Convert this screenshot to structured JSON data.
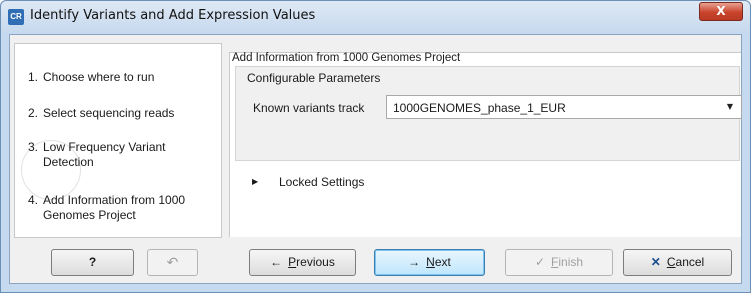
{
  "window": {
    "title": "Identify Variants and Add Expression Values",
    "app_icon_text": "CR",
    "close_glyph": "X"
  },
  "steps": [
    {
      "number": "1.",
      "label": "Choose where to run"
    },
    {
      "number": "2.",
      "label": "Select sequencing reads"
    },
    {
      "number": "3.",
      "label": "Low Frequency Variant Detection"
    },
    {
      "number": "4.",
      "label": "Add Information from 1000 Genomes Project"
    }
  ],
  "content": {
    "section_title": "Add Information from 1000 Genomes Project",
    "group_title": "Configurable Parameters",
    "field_label": "Known variants track",
    "track_value": "1000GENOMES_phase_1_EUR",
    "locked_label": "Locked Settings"
  },
  "buttons": {
    "help": "?",
    "previous_first": "P",
    "previous_rest": "revious",
    "next_first": "N",
    "next_rest": "ext",
    "finish_first": "F",
    "finish_rest": "inish",
    "cancel_first": "C",
    "cancel_rest": "ancel"
  },
  "icons": {
    "help": "question-icon",
    "undo": "undo-arrow-icon",
    "previous": "arrow-left-icon",
    "next": "arrow-right-icon",
    "finish": "checkmark-icon",
    "cancel": "x-icon"
  },
  "colors": {
    "accent_default_button": "#3c7fb1",
    "close_button": "#c9432b",
    "titlebar": "#c6d9ee"
  }
}
